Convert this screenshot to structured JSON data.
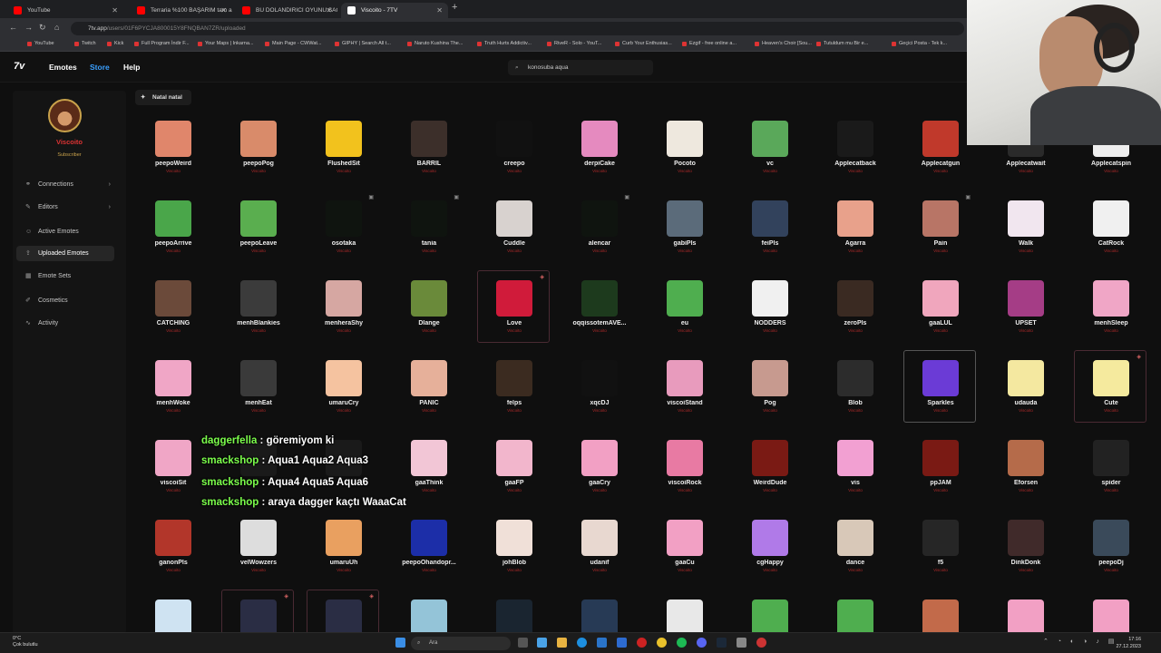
{
  "browser": {
    "tabs": [
      {
        "title": "YouTube",
        "color": "#ff0000",
        "active": false
      },
      {
        "title": "Terraria %100 BAŞARIM tam ar",
        "color": "#ff0000",
        "active": false
      },
      {
        "title": "BU DOLANDIRICI OYUNU SAÇ",
        "color": "#ff0000",
        "active": false
      },
      {
        "title": "Viscoito - 7TV",
        "color": "#ffffff",
        "active": true
      }
    ],
    "close_glyph": "✕",
    "new_tab_glyph": "+",
    "url_domain": "7tv.app",
    "url_path": "/users/01F6PYCJA800015Y8FNQBAN7ZR/uploaded",
    "bookmarks": [
      "YouTube",
      "Twitch",
      "Kick",
      "Full Program İndir F...",
      "Your Maps | Inkarna...",
      "Main Page - CWWat...",
      "GIPHY | Search All t...",
      "Naruto Kushina The...",
      "Truth Hurts Addictiv...",
      "RiveR - Solo - YouT...",
      "Curb Your Enthusias...",
      "Ezgif - free online a...",
      "Heaven's Choir [Sou...",
      "Tutuldum mu Bir e...",
      "Geçici Posta - Tek k..."
    ]
  },
  "site": {
    "logo": "7v",
    "nav": [
      "Emotes",
      "Store",
      "Help"
    ],
    "accent": "#3aa0ff",
    "search_value": "konosuba aqua"
  },
  "sidebar": {
    "username": "Viscoito",
    "role": "Subscriber",
    "items": [
      {
        "label": "Connections",
        "icon": "link-icon",
        "chevron": true
      },
      {
        "label": "Editors",
        "icon": "edit-icon",
        "chevron": true
      },
      {
        "label": "Active Emotes",
        "icon": "smile-icon",
        "chevron": false
      },
      {
        "label": "Uploaded Emotes",
        "icon": "upload-icon",
        "chevron": false,
        "active": true
      },
      {
        "label": "Emote Sets",
        "icon": "layers-icon",
        "chevron": false
      },
      {
        "label": "Cosmetics",
        "icon": "brush-icon",
        "chevron": false
      },
      {
        "label": "Activity",
        "icon": "activity-icon",
        "chevron": false
      }
    ]
  },
  "filter_button": "Natal natal",
  "emote_author": "Viscoito",
  "emotes": [
    [
      "peepoWeird",
      "peepoPog",
      "FlushedSit",
      "BARRIL",
      "creepo",
      "derpiCake",
      "Pocoto",
      "vc",
      "Applecatback",
      "Applecatgun",
      "Applecatwait",
      "Applecatspin"
    ],
    [
      "peepoArrive",
      "peepoLeave",
      "osotaka",
      "tania",
      "Cuddle",
      "alencar",
      "gabiPls",
      "feiPls",
      "Agarra",
      "Pain",
      "Walk",
      "CatRock"
    ],
    [
      "CATCHING",
      "menhBlankies",
      "menheraShy",
      "Dlange",
      "Love",
      "oqqissotemAVE...",
      "eu",
      "NODDERS",
      "zeroPls",
      "gaaLUL",
      "UPSET",
      "menhSleep"
    ],
    [
      "menhWoke",
      "menhEat",
      "umaruCry",
      "PANIC",
      "felps",
      "xqcDJ",
      "viscoiStand",
      "Pog",
      "Blob",
      "Sparkles",
      "udauda",
      "Cute"
    ],
    [
      "viscoiSit",
      "",
      "",
      "gaaThink",
      "gaaFP",
      "gaaCry",
      "viscoiRock",
      "WeirdDude",
      "vis",
      "ppJAM",
      "Eforsen",
      "spider"
    ],
    [
      "ganonPls",
      "velWowzers",
      "umaruUh",
      "peepoOhandopr...",
      "johBlob",
      "udanif",
      "gaaCu",
      "cgHappy",
      "dance",
      "f5",
      "DinkDonk",
      "peepoDj"
    ],
    [
      "",
      "",
      "",
      "",
      "",
      "",
      "",
      "",
      "",
      "",
      "",
      ""
    ]
  ],
  "chat": [
    {
      "user": "daggerfella",
      "msg": ": göremiyom ki"
    },
    {
      "user": "smackshop",
      "msg": ": Aqua1 Aqua2 Aqua3"
    },
    {
      "user": "smackshop",
      "msg": ": Aqua4 Aqua5 Aqua6"
    },
    {
      "user": "smackshop",
      "msg": ": araya dagger kaçtı WaaaCat"
    }
  ],
  "taskbar": {
    "weather_temp": "0°C",
    "weather_desc": "Çok bulutlu",
    "search_placeholder": "Ara",
    "time": "17:16",
    "date": "27.12.2023"
  }
}
